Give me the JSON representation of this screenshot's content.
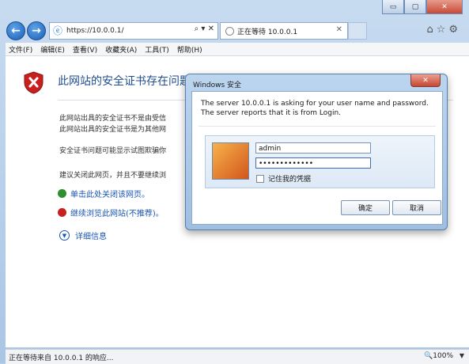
{
  "window": {
    "minimize": "▭",
    "maximize": "▢",
    "close": "✕"
  },
  "nav": {
    "back_icon": "←",
    "forward_icon": "→",
    "url": "https://10.0.0.1/",
    "address_tools": "⌕ ▾ ✕",
    "tab_title": "正在等待 10.0.0.1",
    "tab_close": "✕",
    "right_icons": "⌂☆⚙"
  },
  "menu": {
    "items": [
      "文件(F)",
      "编辑(E)",
      "查看(V)",
      "收藏夹(A)",
      "工具(T)",
      "帮助(H)"
    ]
  },
  "page": {
    "title": "此网站的安全证书存在问题",
    "line1": "此网站出具的安全证书不是由受信",
    "line2": "此网站出具的安全证书是为其他网",
    "line3": "安全证书问题可能显示试图欺骗你",
    "line4": "建议关闭此网页，并且不要继续浏",
    "link_close": "单击此处关闭该网页。",
    "link_continue": "继续浏览此网站(不推荐)。",
    "more_info": "详细信息"
  },
  "status": {
    "text": "正在等待来自 10.0.0.1 的响应...",
    "zoom": "🔍100%",
    "zoom_arrow": "▼"
  },
  "dialog": {
    "title": "Windows 安全",
    "close": "✕",
    "message1": "The server 10.0.0.1 is asking for your user name and password.",
    "message2": "The server reports that it is from Login.",
    "username": "admin",
    "password": "•••••••••••••",
    "remember_label": "记住我的凭据",
    "ok_label": "确定",
    "cancel_label": "取消"
  }
}
